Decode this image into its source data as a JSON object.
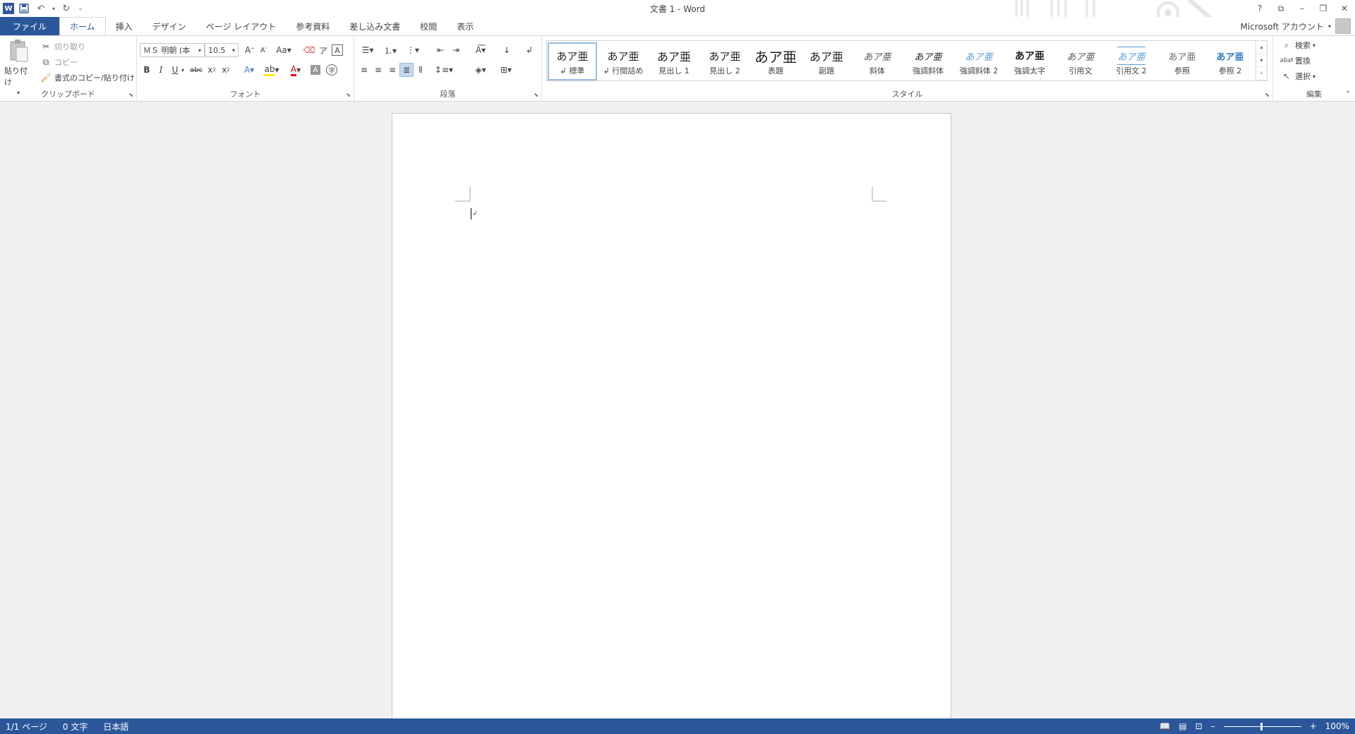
{
  "window": {
    "title": "文書 1 - Word",
    "account": "Microsoft アカウント",
    "controls": [
      "?",
      "⧉",
      "–",
      "❐",
      "✕"
    ]
  },
  "qat": {
    "icons": [
      "word-logo",
      "save-icon",
      "undo-icon",
      "redo-icon",
      "customize-icon"
    ]
  },
  "tabs": {
    "file": "ファイル",
    "home": "ホーム",
    "insert": "挿入",
    "design": "デザイン",
    "layout": "ページ レイアウト",
    "references": "参考資料",
    "mailings": "差し込み文書",
    "review": "校閲",
    "view": "表示"
  },
  "clipboard": {
    "label": "クリップボード",
    "paste": "貼り付け",
    "cut": "切り取り",
    "copy": "コピー",
    "format_painter": "書式のコピー/貼り付け"
  },
  "font": {
    "label": "フォント",
    "name": "ＭＳ 明朝 (本",
    "size": "10.5"
  },
  "paragraph": {
    "label": "段落"
  },
  "styles": {
    "label": "スタイル",
    "items": [
      {
        "preview": "あア亜",
        "name": "標準",
        "mark": "↲"
      },
      {
        "preview": "あア亜",
        "name": "行間詰め",
        "mark": "↲"
      },
      {
        "preview": "あア亜",
        "name": "見出し 1"
      },
      {
        "preview": "あア亜",
        "name": "見出し 2"
      },
      {
        "preview": "あア亜",
        "name": "表題"
      },
      {
        "preview": "あア亜",
        "name": "副題"
      },
      {
        "preview": "あア亜",
        "name": "斜体"
      },
      {
        "preview": "あア亜",
        "name": "強調斜体"
      },
      {
        "preview": "あア亜",
        "name": "強調斜体 2"
      },
      {
        "preview": "あア亜",
        "name": "強調太字"
      },
      {
        "preview": "あア亜",
        "name": "引用文"
      },
      {
        "preview": "あア亜",
        "name": "引用文 2"
      },
      {
        "preview": "あア亜",
        "name": "参照"
      },
      {
        "preview": "あア亜",
        "name": "参照 2"
      }
    ]
  },
  "editing": {
    "label": "編集",
    "find": "検索",
    "replace": "置換",
    "select": "選択"
  },
  "status": {
    "page": "1/1 ページ",
    "words": "0 文字",
    "language": "日本語",
    "zoom": "100%",
    "zoom_level": 1.0
  }
}
